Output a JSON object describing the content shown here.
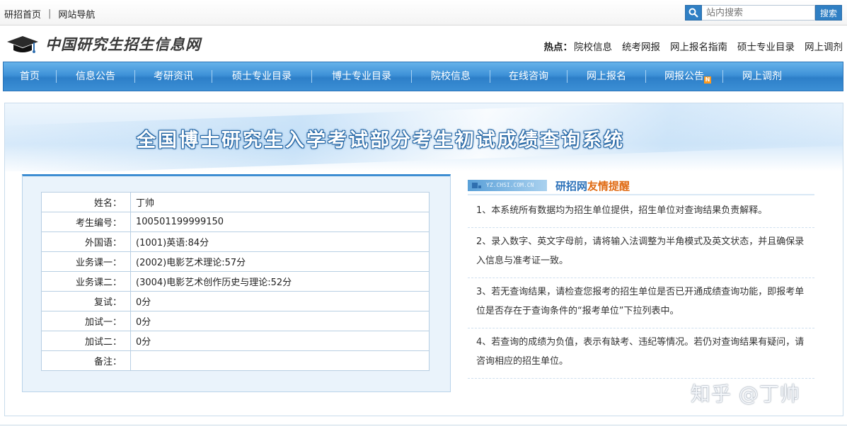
{
  "top": {
    "links": [
      "研招首页",
      "网站导航"
    ],
    "separator": "|",
    "search_placeholder": "站内搜索",
    "search_button": "搜索"
  },
  "logo": {
    "text": "中国研究生招生信息网"
  },
  "hot": {
    "label": "热点：",
    "links": [
      "院校信息",
      "统考网报",
      "网上报名指南",
      "硕士专业目录",
      "网上调剂"
    ]
  },
  "nav": {
    "items": [
      "首页",
      "信息公告",
      "考研资讯",
      "硕士专业目录",
      "博士专业目录",
      "院校信息",
      "在线咨询",
      "网上报名",
      "网报公告",
      "网上调剂"
    ],
    "new_badge": "N"
  },
  "banner": {
    "title": "全国博士研究生入学考试部分考生初试成绩查询系统"
  },
  "result": {
    "rows": [
      {
        "label": "姓名：",
        "value": "丁帅"
      },
      {
        "label": "考生编号：",
        "value": "100501199999150"
      },
      {
        "label": "外国语：",
        "value": "(1001)英语:84分"
      },
      {
        "label": "业务课一：",
        "value": "(2002)电影艺术理论:57分"
      },
      {
        "label": "业务课二：",
        "value": "(3004)电影艺术创作历史与理论:52分"
      },
      {
        "label": "复试：",
        "value": "0分"
      },
      {
        "label": "加试一：",
        "value": "0分"
      },
      {
        "label": "加试二：",
        "value": "0分"
      },
      {
        "label": "备注：",
        "value": ""
      }
    ]
  },
  "notice": {
    "tag": "YZ.CHSI.COM.CN",
    "title_part1": "研招网",
    "title_part2": "友情提醒",
    "items": [
      "1、本系统所有数据均为招生单位提供，招生单位对查询结果负责解释。",
      "2、录入数字、英文字母前，请将输入法调整为半角模式及英文状态，并且确保录入信息与准考证一致。",
      "3、若无查询结果，请检查您报考的招生单位是否已开通成绩查询功能，即报考单位是否存在于查询条件的“报考单位”下拉列表中。",
      "4、若查询的成绩为负值，表示有缺考、违纪等情况。若仍对查询结果有疑问，请咨询相应的招生单位。"
    ]
  },
  "watermark": "知乎 @丁帅",
  "colors": {
    "nav_blue": "#3f92d8",
    "title_blue": "#2b71b9",
    "accent_orange": "#e06a12"
  }
}
